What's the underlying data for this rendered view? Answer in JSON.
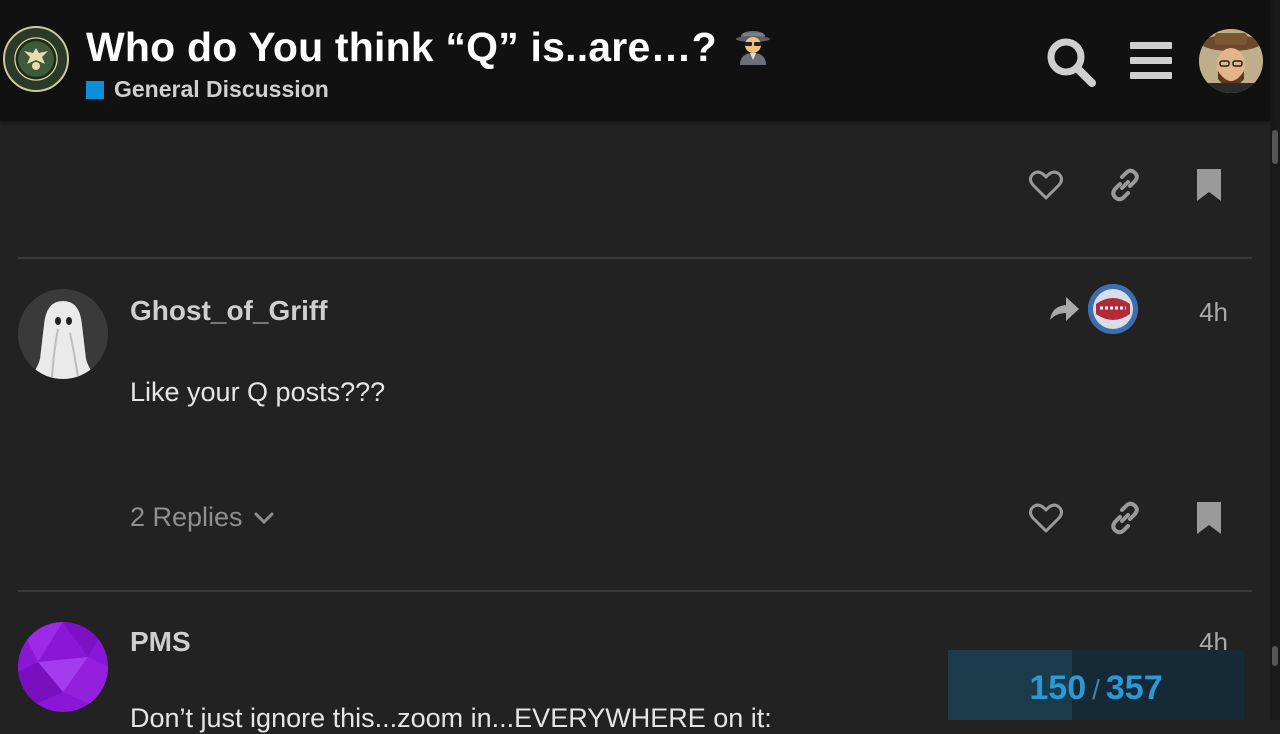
{
  "header": {
    "title": "Who do You think “Q” is..are…?",
    "title_emoji": "spy-detective-emoji",
    "category": "General Discussion",
    "category_color": "#0a8fd8",
    "logo": "infowars-army-logo"
  },
  "posts": [
    {
      "username": "Ghost_of_Griff",
      "time": "4h",
      "body": "Like your Q posts???",
      "replies_label": "2 Replies"
    },
    {
      "username": "PMS",
      "time": "4h",
      "body": "Don’t just ignore this...zoom in...EVERYWHERE on it:"
    }
  ],
  "progress": {
    "current": "150",
    "separator": "/",
    "total": "357"
  },
  "colors": {
    "background": "#222222",
    "header": "#111111",
    "accent": "#2a9ad6"
  }
}
